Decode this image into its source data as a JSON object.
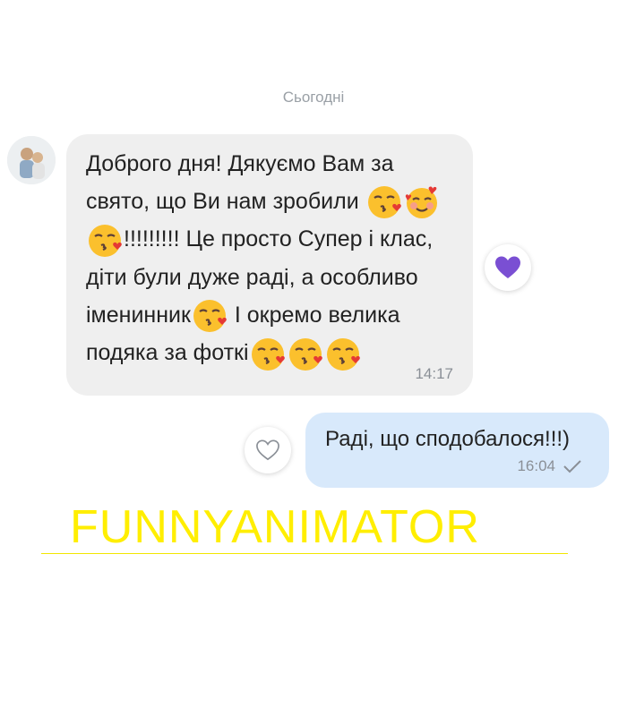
{
  "date_separator": "Сьогодні",
  "incoming": {
    "lines": [
      {
        "text": "Доброго дня! Дякуємо Вам за",
        "emoji_after": 0
      },
      {
        "text": "свято, що Ви нам зробили",
        "emoji_after": 2
      },
      {
        "text": "!!!!!!!!! Це просто Супер і клас,",
        "emoji_before": 1
      },
      {
        "text": "діти були дуже раді, а особливо"
      },
      {
        "text": "іменинник",
        "emoji_after": 1,
        "tail": " І окремо велика"
      },
      {
        "text": "подяка за фоткі",
        "emoji_after": 3
      }
    ],
    "time": "14:17",
    "reaction": "purple-heart-icon"
  },
  "outgoing": {
    "text": "Раді, що сподобалося!!!)",
    "time": "16:04",
    "status": "check-icon"
  },
  "watermark": "FUNNYANIMATOR",
  "colors": {
    "incoming_bubble": "#efefef",
    "outgoing_bubble": "#d8e9fb",
    "reaction_heart": "#7a4fd3",
    "watermark": "#ffee00"
  }
}
